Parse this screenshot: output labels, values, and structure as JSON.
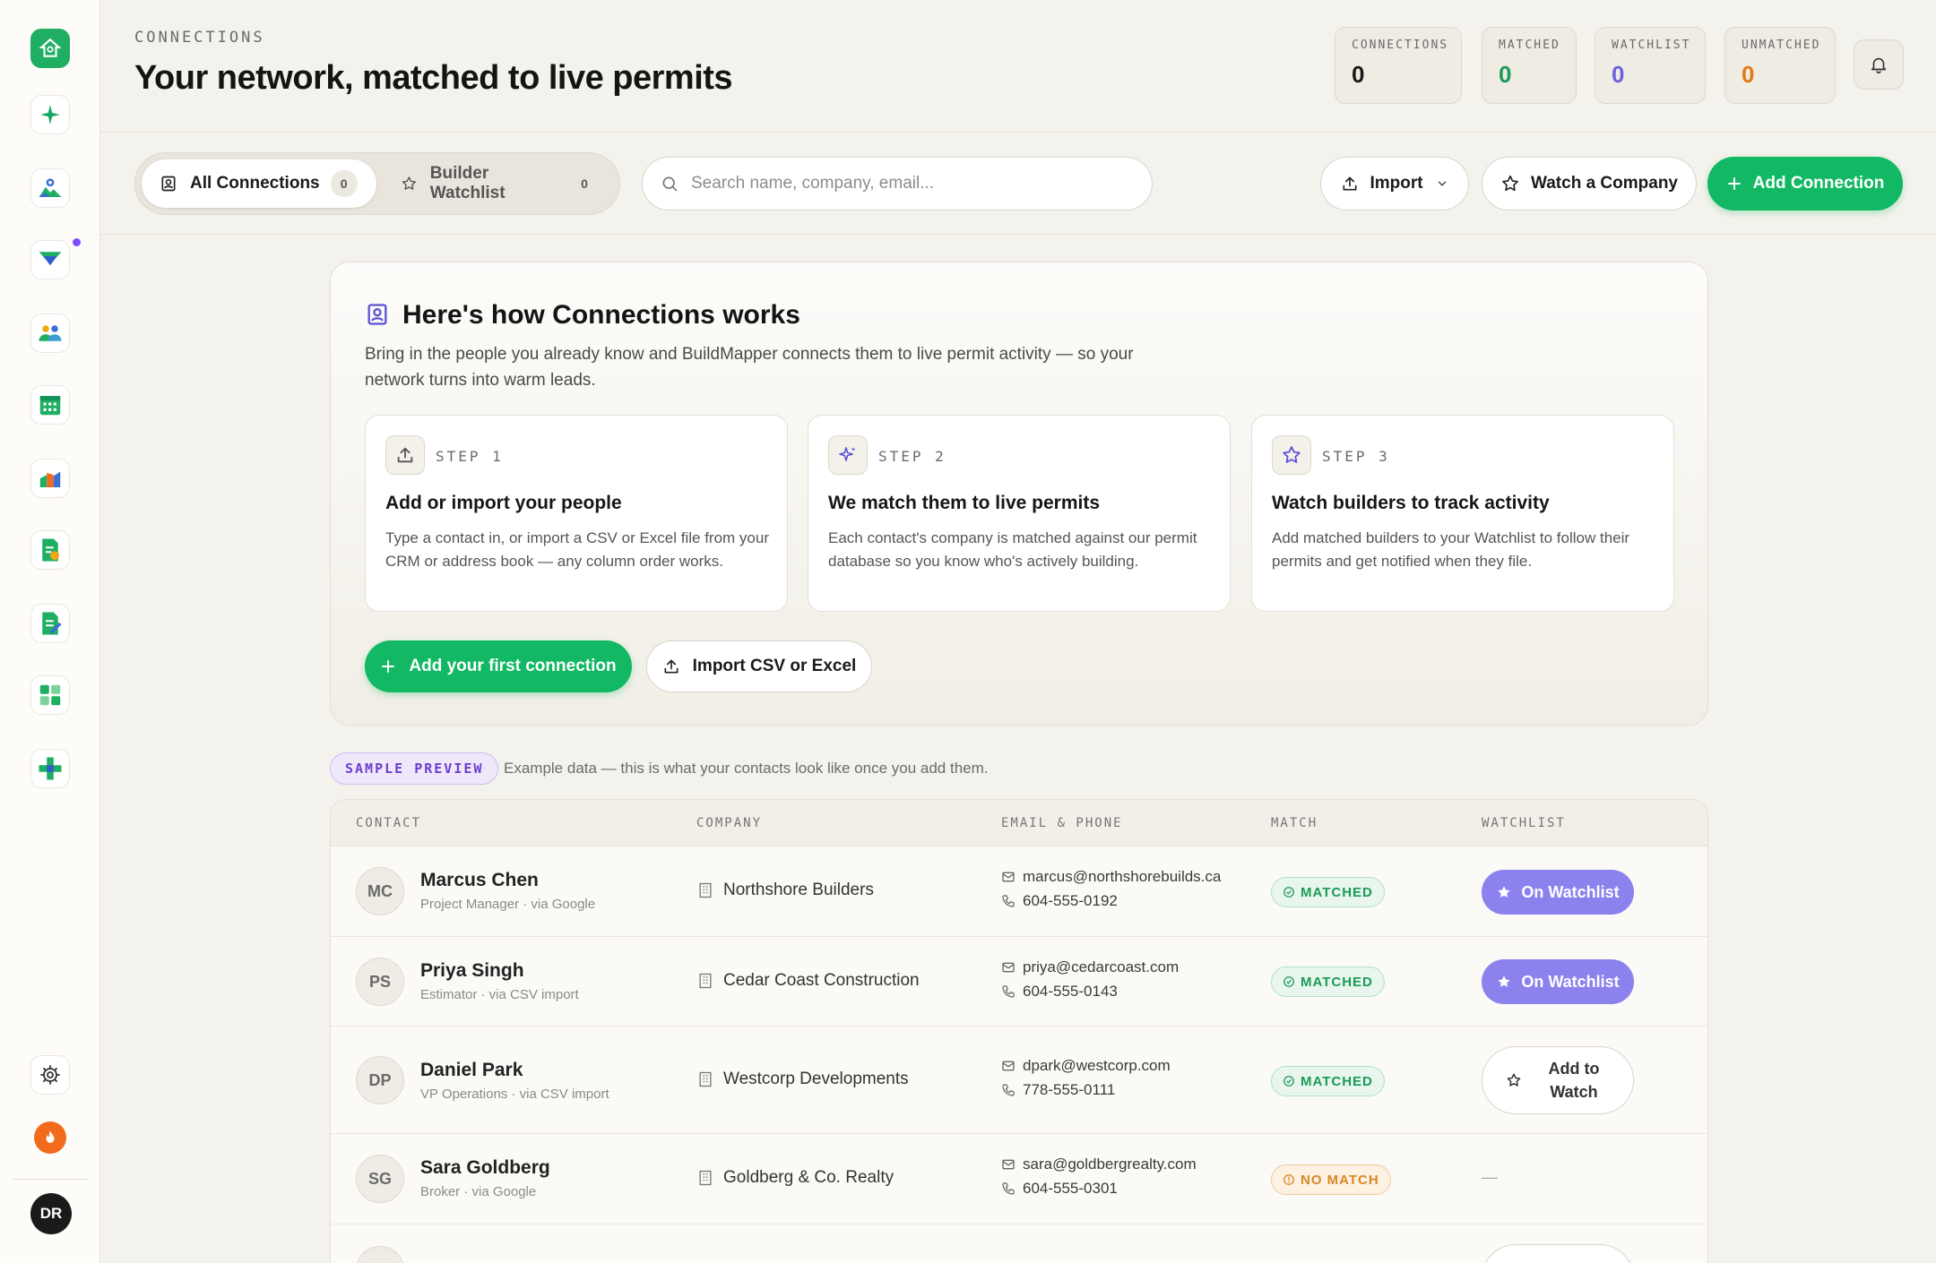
{
  "sidebar": {
    "nav_items": [
      "home",
      "ai-sparkle",
      "map",
      "permits-filter",
      "contacts",
      "calendar",
      "analytics",
      "invoices",
      "documents",
      "dashboard",
      "connections"
    ],
    "bottom": {
      "settings": "settings",
      "streak": "streak",
      "user_initials": "DR"
    }
  },
  "header": {
    "eyebrow": "CONNECTIONS",
    "title": "Your network, matched to live permits",
    "stats": [
      {
        "label": "CONNECTIONS",
        "value": "0",
        "color": "#1a1a1a"
      },
      {
        "label": "MATCHED",
        "value": "0",
        "color": "#1c9a57"
      },
      {
        "label": "WATCHLIST",
        "value": "0",
        "color": "#6a60e0"
      },
      {
        "label": "UNMATCHED",
        "value": "0",
        "color": "#e07b12"
      }
    ]
  },
  "toolbar": {
    "tabs": [
      {
        "label": "All Connections",
        "count": "0"
      },
      {
        "label": "Builder Watchlist",
        "count": "0"
      }
    ],
    "search_placeholder": "Search name, company, email...",
    "import_label": "Import",
    "watch_label": "Watch a Company",
    "add_label": "Add Connection"
  },
  "onboarding": {
    "title": "Here's how Connections works",
    "description": "Bring in the people you already know and BuildMapper connects them to live permit activity — so your network turns into warm leads.",
    "steps": [
      {
        "label": "STEP 1",
        "title": "Add or import your people",
        "text": "Type a contact in, or import a CSV or Excel file from your CRM or address book — any column order works."
      },
      {
        "label": "STEP 2",
        "title": "We match them to live permits",
        "text": "Each contact's company is matched against our permit database so you know who's actively building."
      },
      {
        "label": "STEP 3",
        "title": "Watch builders to track activity",
        "text": "Add matched builders to your Watchlist to follow their permits and get notified when they file."
      }
    ],
    "primary_cta": "Add your first connection",
    "secondary_cta": "Import CSV or Excel"
  },
  "sample": {
    "badge": "SAMPLE PREVIEW",
    "note": "Example data — this is what your contacts look like once you add them.",
    "columns": [
      "CONTACT",
      "COMPANY",
      "EMAIL & PHONE",
      "MATCH",
      "WATCHLIST"
    ],
    "rows": [
      {
        "initials": "MC",
        "name": "Marcus Chen",
        "sub": "Project Manager · via Google",
        "company": "Northshore Builders",
        "email": "marcus@northshorebuilds.ca",
        "phone": "604-555-0192",
        "match": "MATCHED",
        "watch": "On Watchlist"
      },
      {
        "initials": "PS",
        "name": "Priya Singh",
        "sub": "Estimator · via CSV import",
        "company": "Cedar Coast Construction",
        "email": "priya@cedarcoast.com",
        "phone": "604-555-0143",
        "match": "MATCHED",
        "watch": "On Watchlist"
      },
      {
        "initials": "DP",
        "name": "Daniel Park",
        "sub": "VP Operations · via CSV import",
        "company": "Westcorp Developments",
        "email": "dpark@westcorp.com",
        "phone": "778-555-0111",
        "match": "MATCHED",
        "watch": "Add to Watch"
      },
      {
        "initials": "SG",
        "name": "Sara Goldberg",
        "sub": "Broker · via Google",
        "company": "Goldberg & Co. Realty",
        "email": "sara@goldbergrealty.com",
        "phone": "604-555-0301",
        "match": "NO MATCH",
        "watch": "—"
      }
    ]
  }
}
